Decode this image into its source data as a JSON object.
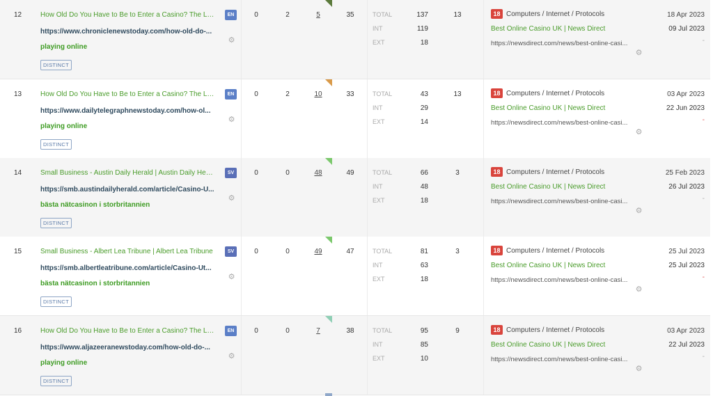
{
  "rows": [
    {
      "index": "12",
      "title": "How Old Do You Have to Be to Enter a Casino? The Leg...",
      "lang": "EN",
      "source_url": "https://www.chroniclenewstoday.com/how-old-do-...",
      "anchor": "playing online",
      "badge": "DISTINCT",
      "m1": "0",
      "m2": "2",
      "m3": "5",
      "m4": "35",
      "flag_color": "#5b7a3b",
      "labels": {
        "total": "TOTAL",
        "int": "INT",
        "ext": "EXT"
      },
      "total": "137",
      "int": "119",
      "ext": "18",
      "unique": "13",
      "cat_num": "18",
      "category": "Computers / Internet / Protocols",
      "target_title": "Best Online Casino UK | News Direct",
      "target_url": "https://newsdirect.com/news/best-online-casi...",
      "first_seen": "18 Apr 2023",
      "last_seen": "09 Jul 2023",
      "status": "-",
      "status_color": "#aaaaaa"
    },
    {
      "index": "13",
      "title": "How Old Do You Have to Be to Enter a Casino? The Leg...",
      "lang": "EN",
      "source_url": "https://www.dailytelegraphnewstoday.com/how-ol...",
      "anchor": "playing online",
      "badge": "DISTINCT",
      "m1": "0",
      "m2": "2",
      "m3": "10",
      "m4": "33",
      "flag_color": "#d99a4a",
      "labels": {
        "total": "TOTAL",
        "int": "INT",
        "ext": "EXT"
      },
      "total": "43",
      "int": "29",
      "ext": "14",
      "unique": "13",
      "cat_num": "18",
      "category": "Computers / Internet / Protocols",
      "target_title": "Best Online Casino UK | News Direct",
      "target_url": "https://newsdirect.com/news/best-online-casi...",
      "first_seen": "03 Apr 2023",
      "last_seen": "22 Jun 2023",
      "status": "-",
      "status_color": "#e05050"
    },
    {
      "index": "14",
      "title": "Small Business - Austin Daily Herald | Austin Daily Herald",
      "lang": "SV",
      "source_url": "https://smb.austindailyherald.com/article/Casino-U...",
      "anchor": "bästa nätcasinon i storbritannien",
      "badge": "DISTINCT",
      "m1": "0",
      "m2": "0",
      "m3": "48",
      "m4": "49",
      "flag_color": "#7bc86c",
      "labels": {
        "total": "TOTAL",
        "int": "INT",
        "ext": "EXT"
      },
      "total": "66",
      "int": "48",
      "ext": "18",
      "unique": "3",
      "cat_num": "18",
      "category": "Computers / Internet / Protocols",
      "target_title": "Best Online Casino UK | News Direct",
      "target_url": "https://newsdirect.com/news/best-online-casi...",
      "first_seen": "25 Feb 2023",
      "last_seen": "26 Jul 2023",
      "status": "-",
      "status_color": "#aaaaaa"
    },
    {
      "index": "15",
      "title": "Small Business - Albert Lea Tribune | Albert Lea Tribune",
      "lang": "SV",
      "source_url": "https://smb.albertleatribune.com/article/Casino-Ut...",
      "anchor": "bästa nätcasinon i storbritannien",
      "badge": "DISTINCT",
      "m1": "0",
      "m2": "0",
      "m3": "49",
      "m4": "47",
      "flag_color": "#7bc86c",
      "labels": {
        "total": "TOTAL",
        "int": "INT",
        "ext": "EXT"
      },
      "total": "81",
      "int": "63",
      "ext": "18",
      "unique": "3",
      "cat_num": "18",
      "category": "Computers / Internet / Protocols",
      "target_title": "Best Online Casino UK | News Direct",
      "target_url": "https://newsdirect.com/news/best-online-casi...",
      "first_seen": "25 Jul 2023",
      "last_seen": "25 Jul 2023",
      "status": "-",
      "status_color": "#e05050"
    },
    {
      "index": "16",
      "title": "How Old Do You Have to Be to Enter a Casino? The Leg...",
      "lang": "EN",
      "source_url": "https://www.aljazeeranewstoday.com/how-old-do-...",
      "anchor": "playing online",
      "badge": "DISTINCT",
      "m1": "0",
      "m2": "0",
      "m3": "7",
      "m4": "38",
      "flag_color": "#8fcfb5",
      "labels": {
        "total": "TOTAL",
        "int": "INT",
        "ext": "EXT"
      },
      "total": "95",
      "int": "85",
      "ext": "10",
      "unique": "9",
      "cat_num": "18",
      "category": "Computers / Internet / Protocols",
      "target_title": "Best Online Casino UK | News Direct",
      "target_url": "https://newsdirect.com/news/best-online-casi...",
      "first_seen": "03 Apr 2023",
      "last_seen": "22 Jul 2023",
      "status": "-",
      "status_color": "#aaaaaa"
    }
  ]
}
